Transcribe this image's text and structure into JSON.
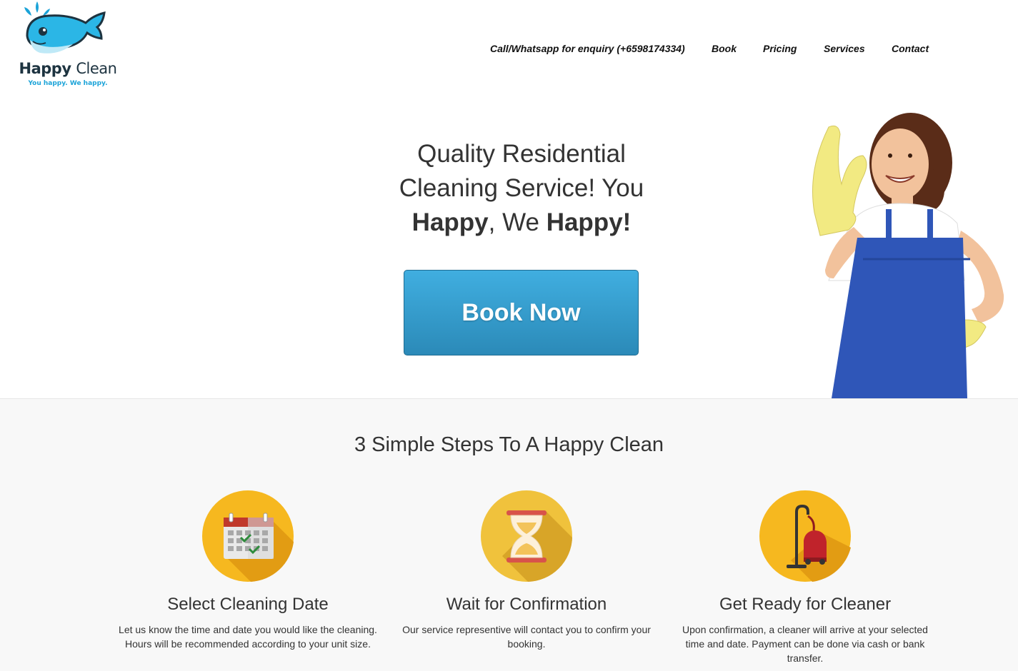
{
  "logo": {
    "name_bold": "Happy",
    "name_regular": "Clean",
    "tagline": "You happy. We happy."
  },
  "nav": {
    "items": [
      {
        "label": "Call/Whatsapp for enquiry (+6598174334)"
      },
      {
        "label": "Book"
      },
      {
        "label": "Pricing"
      },
      {
        "label": "Services"
      },
      {
        "label": "Contact"
      }
    ]
  },
  "hero": {
    "line1": "Quality Residential",
    "line2": "Cleaning Service! You",
    "line3_bold_a": "Happy",
    "line3_mid": ", We ",
    "line3_bold_b": "Happy!",
    "button_label": "Book Now"
  },
  "steps": {
    "title": "3 Simple Steps To A Happy Clean",
    "items": [
      {
        "icon": "calendar-icon",
        "title": "Select Cleaning Date",
        "desc": "Let us know the time and date you would like the cleaning. Hours will be recommended according to your unit size."
      },
      {
        "icon": "hourglass-icon",
        "title": "Wait for Confirmation",
        "desc": "Our service representive will contact you to confirm your booking."
      },
      {
        "icon": "vacuum-cleaner-icon",
        "title": "Get Ready for Cleaner",
        "desc": "Upon confirmation, a cleaner will arrive at your selected time and date. Payment can be done via cash or bank transfer."
      }
    ]
  },
  "colors": {
    "button": "#3aa3d6",
    "logo_blue": "#1ba3d8",
    "icon_yellow": "#f6b81f",
    "section_bg": "#f8f8f8"
  }
}
